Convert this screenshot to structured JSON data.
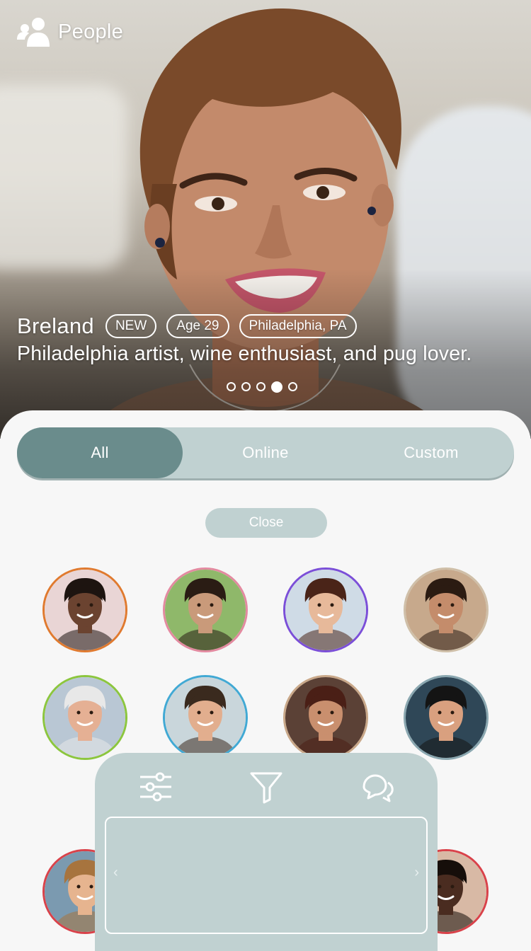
{
  "header": {
    "title": "People",
    "icon": "people-icon"
  },
  "profile": {
    "name": "Breland",
    "badge": "NEW",
    "age": "Age 29",
    "location": "Philadelphia, PA",
    "bio": "Philadelphia artist, wine enthusiast, and pug lover.",
    "carousel": {
      "count": 5,
      "active_index": 4
    }
  },
  "filter_tabs": [
    {
      "label": "All",
      "active": true
    },
    {
      "label": "Online",
      "active": false
    },
    {
      "label": "Custom",
      "active": false
    }
  ],
  "close_button": {
    "label": "Close"
  },
  "avatars": [
    {
      "ring": "#e07a2f",
      "skin": "#6b4330",
      "hair": "#1d1410",
      "bg": "#e9d5d5"
    },
    {
      "ring": "#e38aa0",
      "skin": "#c99a7a",
      "hair": "#2a1c14",
      "bg": "#8fb86a"
    },
    {
      "ring": "#7b4fd8",
      "skin": "#e7b99a",
      "hair": "#4a2418",
      "bg": "#cfdbe6"
    },
    {
      "ring": "#cfbfa8",
      "skin": "#c48c6b",
      "hair": "#2b1b12",
      "bg": "#c7a98c"
    },
    {
      "ring": "#8cc63e",
      "skin": "#e5b094",
      "hair": "#e8e8e8",
      "bg": "#b9c7d4"
    },
    {
      "ring": "#41a9d4",
      "skin": "#e2ae8e",
      "hair": "#3a2a1e",
      "bg": "#c9d6db"
    },
    {
      "ring": "#c9a889",
      "skin": "#c98f6e",
      "hair": "#4a1f16",
      "bg": "#5b4136"
    },
    {
      "ring": "#8aa7b0",
      "skin": "#d9a07f",
      "hair": "#141414",
      "bg": "#2f4757"
    },
    {
      "ring": "#d9424a",
      "skin": "#e6b48f",
      "hair": "#a7743e",
      "bg": "#7b9ab0"
    },
    {
      "ring": "#d9424a",
      "skin": "#4a2c20",
      "hair": "#160e0a",
      "bg": "#d8b9a5"
    }
  ],
  "toolbar": {
    "items": [
      "sliders-icon",
      "filter-icon",
      "chat-icon"
    ],
    "prev": "‹",
    "next": "›"
  },
  "colors": {
    "accent": "#6a8c8c",
    "panel": "#c0d1d1"
  }
}
